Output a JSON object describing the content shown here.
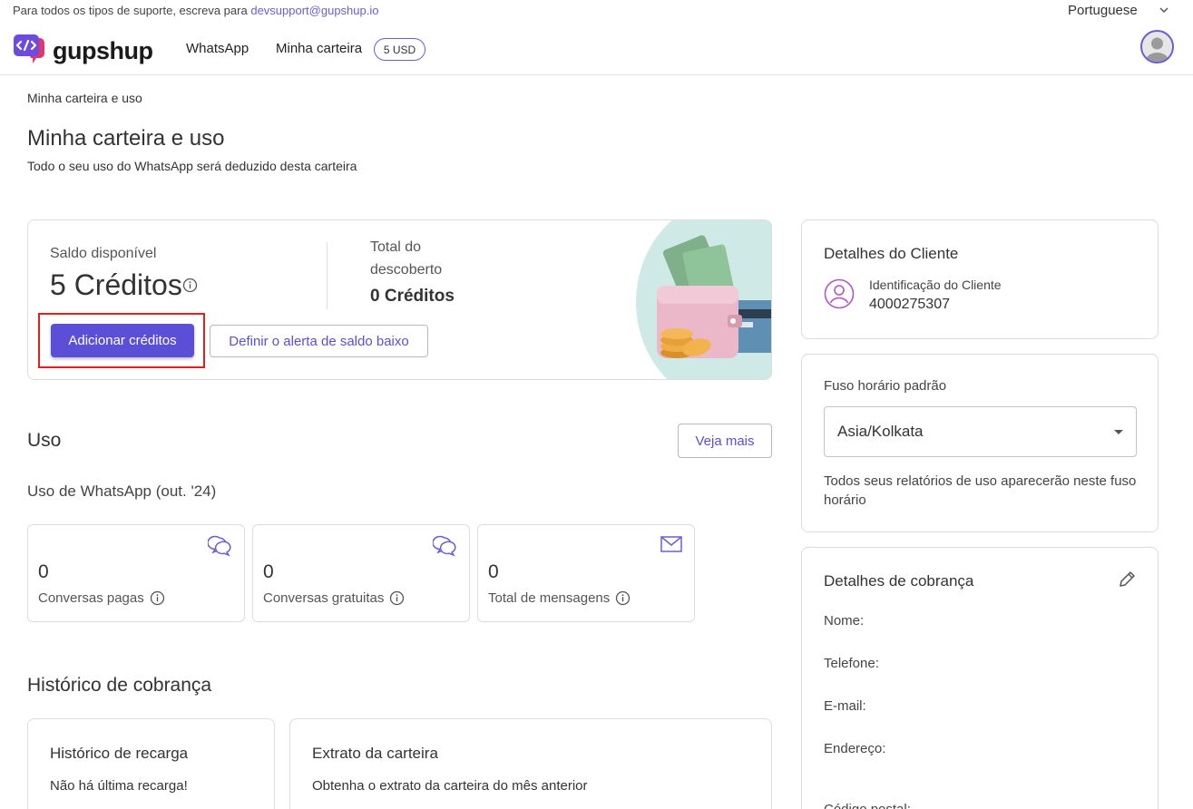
{
  "header": {
    "support_text": "Para todos os tipos de suporte, escreva para",
    "support_email": "devsupport@gupshup.io",
    "language": "Portuguese",
    "logo_text": "gupshup",
    "nav": {
      "whatsapp": "WhatsApp",
      "wallet": "Minha carteira",
      "wallet_badge": "5 USD"
    }
  },
  "page": {
    "breadcrumb": "Minha carteira e uso",
    "title": "Minha carteira e uso",
    "subtitle": "Todo o seu uso do WhatsApp será deduzido desta carteira"
  },
  "balance": {
    "available_label": "Saldo disponível",
    "available_value": "5 Créditos",
    "overdraft_label": "Total do descoberto",
    "overdraft_value": "0 Créditos",
    "add_button": "Adicionar créditos",
    "alert_button": "Definir o alerta de saldo baixo"
  },
  "usage": {
    "title": "Uso",
    "see_more": "Veja mais",
    "subtitle": "Uso de WhatsApp (out. '24)",
    "stats": [
      {
        "value": "0",
        "label": "Conversas pagas",
        "icon": "chat-bubbles-icon"
      },
      {
        "value": "0",
        "label": "Conversas gratuitas",
        "icon": "chat-bubbles-icon"
      },
      {
        "value": "0",
        "label": "Total de mensagens",
        "icon": "envelope-icon"
      }
    ]
  },
  "billing_history": {
    "title": "Histórico de cobrança",
    "recharge_title": "Histórico de recarga",
    "recharge_text": "Não há última recarga!",
    "statement_title": "Extrato da carteira",
    "statement_text": "Obtenha o extrato da carteira do mês anterior"
  },
  "client": {
    "title": "Detalhes do Cliente",
    "id_label": "Identificação do Cliente",
    "id_value": "4000275307"
  },
  "timezone": {
    "label": "Fuso horário padrão",
    "value": "Asia/Kolkata",
    "note": "Todos seus relatórios de uso aparecerão neste fuso horário"
  },
  "billing": {
    "title": "Detalhes de cobrança",
    "fields": [
      "Nome:",
      "Telefone:",
      "E-mail:",
      "Endereço:",
      "Código postal:"
    ]
  },
  "colors": {
    "accent": "#5a4fd6",
    "highlight": "#e01f1f"
  }
}
